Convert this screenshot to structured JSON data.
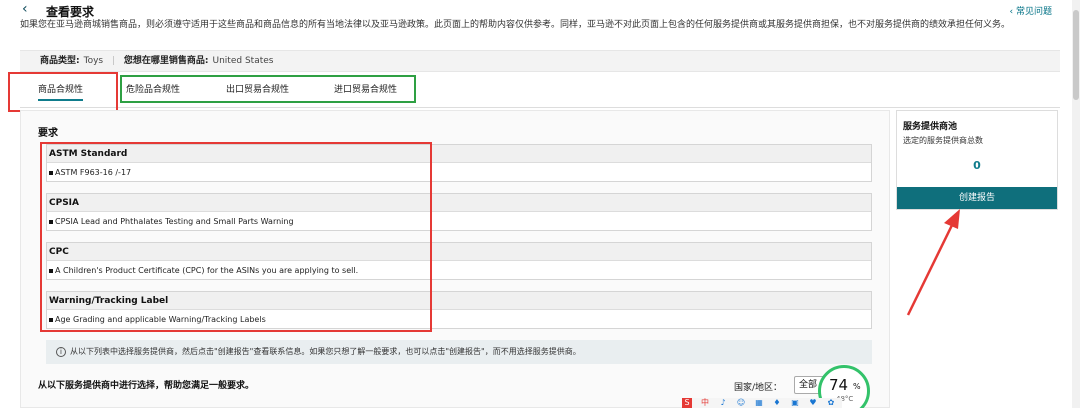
{
  "header": {
    "title": "查看要求",
    "help_link": "常见问题"
  },
  "notice": "如果您在亚马逊商城销售商品，则必须遵守适用于这些商品和商品信息的所有当地法律以及亚马逊政策。此页面上的帮助内容仅供参考。同样，亚马逊不对此页面上包含的任何服务提供商或其服务提供商担保，也不对服务提供商的绩效承担任何义务。",
  "meta": {
    "product_type_label": "商品类型:",
    "product_type_value": "Toys",
    "sell_where_label": "您想在哪里销售商品:",
    "sell_where_value": "United States"
  },
  "tabs": [
    {
      "label": "商品合规性",
      "active": true
    },
    {
      "label": "危险品合规性",
      "active": false
    },
    {
      "label": "出口贸易合规性",
      "active": false
    },
    {
      "label": "进口贸易合规性",
      "active": false
    }
  ],
  "requirements": {
    "title": "要求",
    "items": [
      {
        "name": "ASTM Standard",
        "detail": "ASTM F963-16 /-17"
      },
      {
        "name": "CPSIA",
        "detail": "CPSIA Lead and Phthalates Testing and Small Parts Warning"
      },
      {
        "name": "CPC",
        "detail": "A Children's Product Certificate (CPC) for the ASINs you are applying to sell."
      },
      {
        "name": "Warning/Tracking Label",
        "detail": "Age Grading and applicable Warning/Tracking Labels"
      }
    ]
  },
  "info_bar": "从以下列表中选择服务提供商，然后点击\"创建报告\"查看联系信息。如果您只想了解一般要求，也可以点击\"创建报告\"，而不用选择服务提供商。",
  "choose": {
    "title": "从以下服务提供商中进行选择，帮助您满足一般要求。",
    "region_label": "国家/地区：",
    "region_value": "全部"
  },
  "sidebar": {
    "title": "服务提供商池",
    "subtitle": "选定的服务提供商总数",
    "count": "0",
    "button_label": "创建报告"
  },
  "gauge": {
    "value": "74",
    "unit": "%",
    "temp": "48°C"
  },
  "taskbar_icons": [
    "S",
    "中",
    "♪",
    "☺",
    "▦",
    "♦",
    "▣",
    "♥",
    "✿"
  ],
  "colors": {
    "accent": "#0f6f7c",
    "annotation_red": "#e53935",
    "annotation_green": "#2ea043",
    "gauge_green": "#33c26a"
  }
}
